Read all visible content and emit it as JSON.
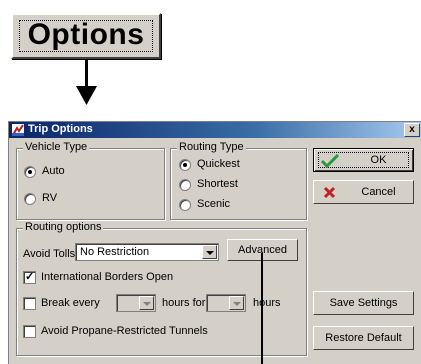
{
  "callout": {
    "label": "Options"
  },
  "dialog": {
    "title": "Trip Options",
    "close": "x",
    "vehicle_type": {
      "legend": "Vehicle Type",
      "options": [
        "Auto",
        "RV"
      ],
      "selected": "Auto"
    },
    "routing_type": {
      "legend": "Routing Type",
      "options": [
        "Quickest",
        "Shortest",
        "Scenic"
      ],
      "selected": "Quickest"
    },
    "routing_options": {
      "legend": "Routing options",
      "avoid_tolls_label": "Avoid Tolls",
      "avoid_tolls_value": "No Restriction",
      "advanced_label": "Advanced",
      "intl_borders_label": "International Borders Open",
      "intl_borders_checked": true,
      "break_every_label": "Break every",
      "hours_for_label": "hours for",
      "hours_label": "hours",
      "avoid_propane_label": "Avoid Propane-Restricted Tunnels",
      "avoid_propane_checked": false
    },
    "buttons": {
      "ok": "OK",
      "cancel": "Cancel",
      "save_settings": "Save Settings",
      "restore_default": "Restore Default"
    }
  },
  "colors": {
    "titlebar_start": "#0a246a",
    "titlebar_end": "#a6caf0",
    "ok_check": "#2a9a3a",
    "cancel_x": "#c02020"
  }
}
